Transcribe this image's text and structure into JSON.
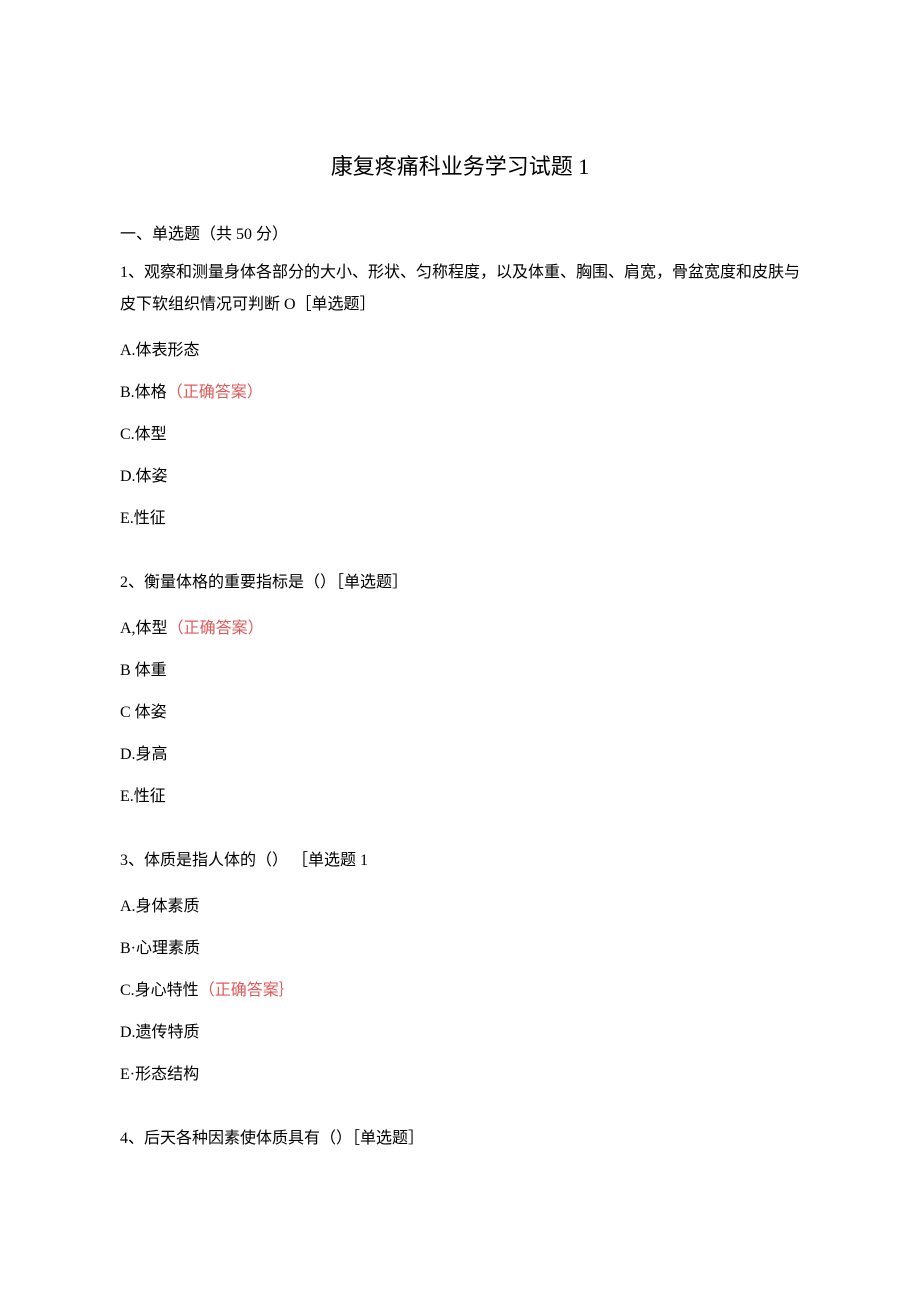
{
  "title": "康复疼痛科业务学习试题 1",
  "section_header": "一、单选题（共 50 分）",
  "q1": {
    "text": "1、观察和测量身体各部分的大小、形状、匀称程度，以及体重、胸围、肩宽，骨盆宽度和皮肤与皮下软组织情况可判断 O［单选题］",
    "a": "A.体表形态",
    "b": "B.体格",
    "b_mark": "（正确答案）",
    "c": "C.体型",
    "d": "D.体姿",
    "e": "E.性征"
  },
  "q2": {
    "text": "2、衡量体格的重要指标是（）［单选题］",
    "a": "A,体型",
    "a_mark": "（正确答案）",
    "b": "B 体重",
    "c": "C 体姿",
    "d": "D.身高",
    "e": "E.性征"
  },
  "q3": {
    "text": "3、体质是指人体的（） ［单选题 1",
    "a": "A.身体素质",
    "b": "B·心理素质",
    "c": "C.身心特性",
    "c_mark": "（正确答案｝",
    "d": "D.遗传特质",
    "e": "E·形态结构"
  },
  "q4": {
    "text": "4、后天各种因素使体质具有（）［单选题］"
  }
}
